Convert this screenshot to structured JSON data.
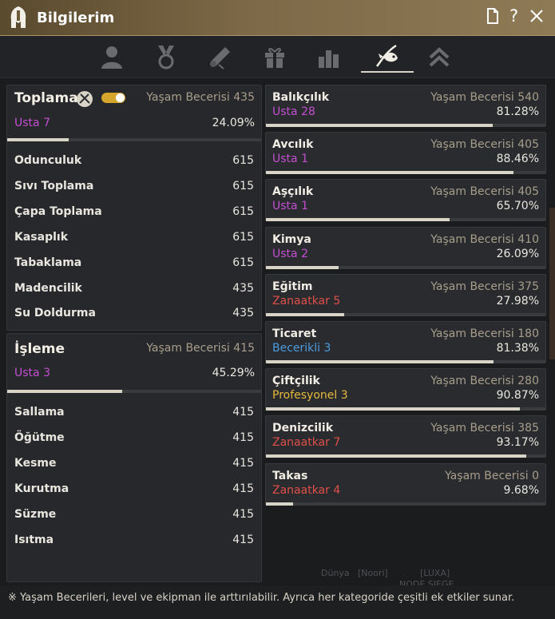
{
  "window": {
    "title": "Bilgilerim",
    "icons": [
      "helmet-logo-icon",
      "document-icon",
      "help-icon",
      "close-icon"
    ]
  },
  "tabs": [
    {
      "name": "profile-tab",
      "icon": "person-icon"
    },
    {
      "name": "medal-tab",
      "icon": "medal-icon"
    },
    {
      "name": "scroll-tab",
      "icon": "scroll-icon"
    },
    {
      "name": "gift-tab",
      "icon": "gift-icon"
    },
    {
      "name": "stats-tab",
      "icon": "bar-chart-icon"
    },
    {
      "name": "life-skills-tab",
      "icon": "fishing-icon",
      "active": true
    },
    {
      "name": "rank-tab",
      "icon": "chevrons-up-icon"
    }
  ],
  "gathering": {
    "title": "Toplama",
    "skill_label": "Yaşam Becerisi",
    "skill_value": "435",
    "rank_name": "Usta",
    "rank_level": "7",
    "percent": "24.09%",
    "progress": 24.09,
    "rows": [
      {
        "name": "Odunculuk",
        "value": "615"
      },
      {
        "name": "Sıvı Toplama",
        "value": "615"
      },
      {
        "name": "Çapa Toplama",
        "value": "615"
      },
      {
        "name": "Kasaplık",
        "value": "615"
      },
      {
        "name": "Tabaklama",
        "value": "615"
      },
      {
        "name": "Madencilik",
        "value": "435"
      },
      {
        "name": "Su Doldurma",
        "value": "435"
      }
    ]
  },
  "processing": {
    "title": "İşleme",
    "skill_label": "Yaşam Becerisi",
    "skill_value": "415",
    "rank_name": "Usta",
    "rank_level": "3",
    "percent": "45.29%",
    "progress": 45.29,
    "rows": [
      {
        "name": "Sallama",
        "value": "415"
      },
      {
        "name": "Öğütme",
        "value": "415"
      },
      {
        "name": "Kesme",
        "value": "415"
      },
      {
        "name": "Kurutma",
        "value": "415"
      },
      {
        "name": "Süzme",
        "value": "415"
      },
      {
        "name": "Isıtma",
        "value": "415"
      }
    ]
  },
  "skills": [
    {
      "name": "Balıkçılık",
      "skill_label": "Yaşam Becerisi",
      "skill_value": "540",
      "rank_name": "Usta",
      "rank_level": "28",
      "rank_color": "usta",
      "percent": "81.28%",
      "progress": 81.28
    },
    {
      "name": "Avcılık",
      "skill_label": "Yaşam Becerisi",
      "skill_value": "405",
      "rank_name": "Usta",
      "rank_level": "1",
      "rank_color": "usta",
      "percent": "88.46%",
      "progress": 88.46
    },
    {
      "name": "Aşçılık",
      "skill_label": "Yaşam Becerisi",
      "skill_value": "405",
      "rank_name": "Usta",
      "rank_level": "1",
      "rank_color": "usta",
      "percent": "65.70%",
      "progress": 65.7
    },
    {
      "name": "Kimya",
      "skill_label": "Yaşam Becerisi",
      "skill_value": "410",
      "rank_name": "Usta",
      "rank_level": "2",
      "rank_color": "usta",
      "percent": "26.09%",
      "progress": 26.09
    },
    {
      "name": "Eğitim",
      "skill_label": "Yaşam Becerisi",
      "skill_value": "375",
      "rank_name": "Zanaatkar",
      "rank_level": "5",
      "rank_color": "zan",
      "percent": "27.98%",
      "progress": 27.98
    },
    {
      "name": "Ticaret",
      "skill_label": "Yaşam Becerisi",
      "skill_value": "180",
      "rank_name": "Becerikli",
      "rank_level": "3",
      "rank_color": "bec",
      "percent": "81.38%",
      "progress": 81.38
    },
    {
      "name": "Çiftçilik",
      "skill_label": "Yaşam Becerisi",
      "skill_value": "280",
      "rank_name": "Profesyonel",
      "rank_level": "3",
      "rank_color": "pro",
      "percent": "90.87%",
      "progress": 90.87
    },
    {
      "name": "Denizcilik",
      "skill_label": "Yaşam Becerisi",
      "skill_value": "385",
      "rank_name": "Zanaatkar",
      "rank_level": "7",
      "rank_color": "zan",
      "percent": "93.17%",
      "progress": 93.17
    },
    {
      "name": "Takas",
      "skill_label": "Yaşam Becerisi",
      "skill_value": "0",
      "rank_name": "Zanaatkar",
      "rank_level": "4",
      "rank_color": "zan",
      "percent": "9.68%",
      "progress": 9.68
    }
  ],
  "rank_colors": {
    "usta": "#c44fd2",
    "zan": "#e0504a",
    "bec": "#4b9ce0",
    "pro": "#e6b93c"
  },
  "footer": {
    "note": "※ Yaşam Becerileri, level ve ekipman ile arttırılabilir. Ayrıca her kategoride çeşitli ek etkiler sunar."
  },
  "background_text": {
    "a": "Dünya",
    "b": "[Noori]",
    "c": "[LUXA]",
    "d": "NODE SIEGE"
  }
}
